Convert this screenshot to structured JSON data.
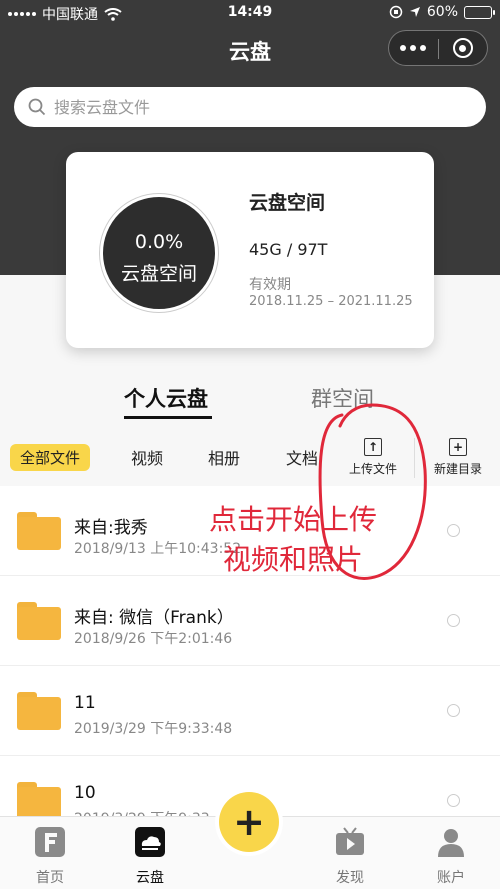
{
  "status": {
    "carrier": "中国联通",
    "time": "14:49",
    "battery": "60%",
    "battery_level": 0.6
  },
  "nav": {
    "title": "云盘",
    "more_icon": "more-dots-icon",
    "close_icon": "target-circle-icon"
  },
  "search": {
    "placeholder": "搜索云盘文件"
  },
  "storage": {
    "percent": "0.0%",
    "ring_label": "云盘空间",
    "title": "云盘空间",
    "used_total": "45G / 97T",
    "validity_label": "有效期",
    "validity_range": "2018.11.25 – 2021.11.25"
  },
  "tabs": {
    "personal": "个人云盘",
    "group": "群空间"
  },
  "filters": {
    "all": "全部文件",
    "video": "视频",
    "album": "相册",
    "doc": "文档",
    "upload": "上传文件",
    "new_dir": "新建目录"
  },
  "files": [
    {
      "name": "来自:我秀",
      "date": "2018/9/13 上午10:43:52"
    },
    {
      "name": "来自: 微信（Frank）",
      "date": "2018/9/26 下午2:01:46"
    },
    {
      "name": "11",
      "date": "2019/3/29 下午9:33:48"
    },
    {
      "name": "10",
      "date": "2019/3/29 下午9:33"
    }
  ],
  "annotation": {
    "line1": "点击开始上传",
    "line2": "视频和照片",
    "color": "#e0283a"
  },
  "bottom_nav": {
    "home": "首页",
    "cloud": "云盘",
    "add": "+",
    "discover": "发现",
    "account": "账户"
  },
  "colors": {
    "header_bg": "#3a3a3a",
    "accent_yellow": "#f9d64a",
    "folder": "#f5b63f"
  }
}
